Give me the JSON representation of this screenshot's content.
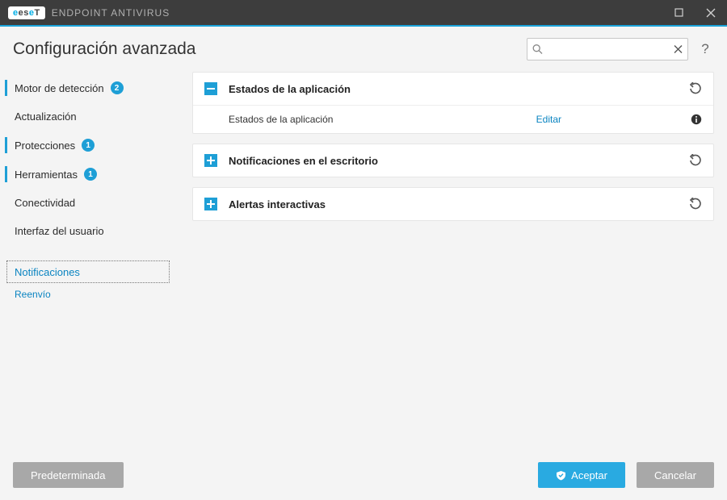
{
  "titlebar": {
    "brand_prefix": "es",
    "brand_e": "e",
    "brand_suffix": "T",
    "product": "ENDPOINT ANTIVIRUS"
  },
  "header": {
    "title": "Configuración avanzada",
    "search_placeholder": "",
    "help": "?"
  },
  "sidebar": {
    "items": [
      {
        "label": "Motor de detección",
        "badge": "2",
        "marked": true
      },
      {
        "label": "Actualización",
        "badge": null,
        "marked": false
      },
      {
        "label": "Protecciones",
        "badge": "1",
        "marked": true
      },
      {
        "label": "Herramientas",
        "badge": "1",
        "marked": true
      },
      {
        "label": "Conectividad",
        "badge": null,
        "marked": false
      },
      {
        "label": "Interfaz del usuario",
        "badge": null,
        "marked": false
      }
    ],
    "selected": {
      "label": "Notificaciones"
    },
    "child": {
      "label": "Reenvío"
    }
  },
  "panels": [
    {
      "expanded": true,
      "title": "Estados de la aplicación",
      "body_label": "Estados de la aplicación",
      "body_link": "Editar"
    },
    {
      "expanded": false,
      "title": "Notificaciones en el escritorio"
    },
    {
      "expanded": false,
      "title": "Alertas interactivas"
    }
  ],
  "footer": {
    "default_btn": "Predeterminada",
    "accept_btn": "Aceptar",
    "cancel_btn": "Cancelar"
  }
}
